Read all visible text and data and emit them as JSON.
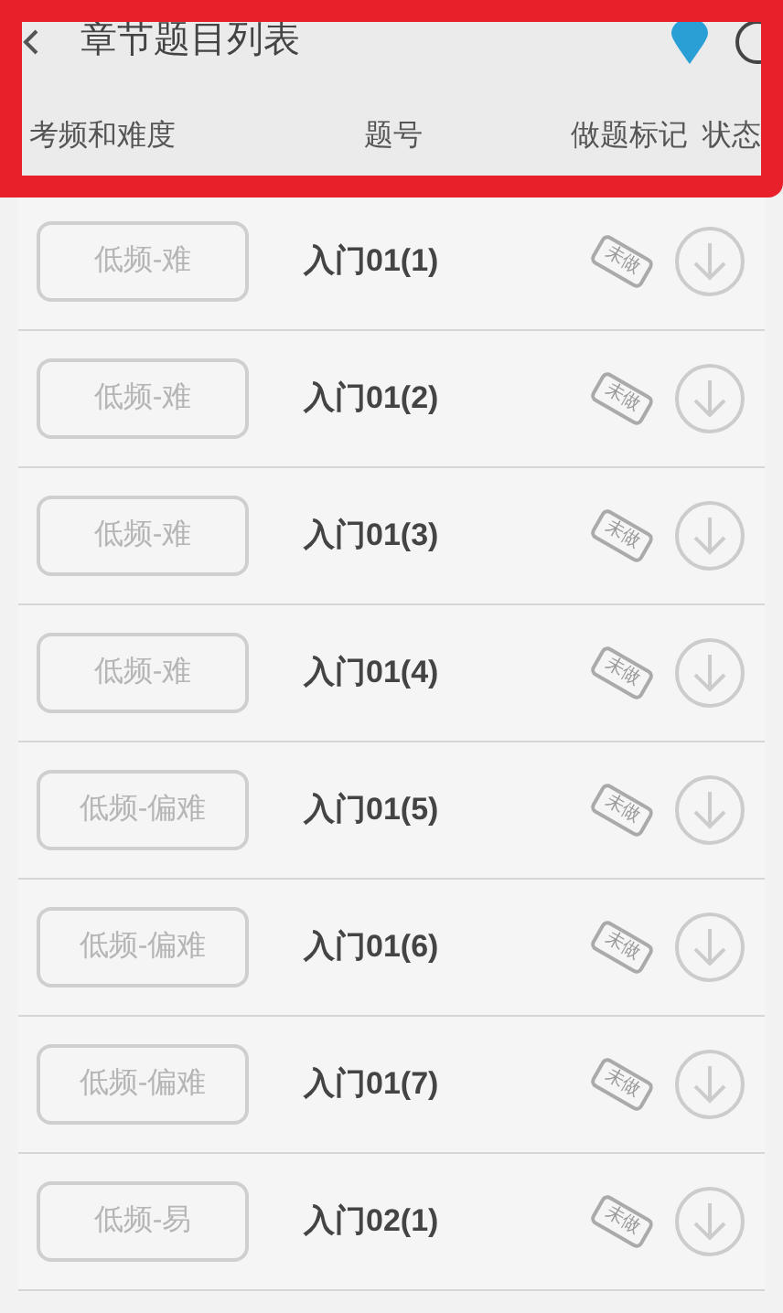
{
  "header": {
    "title": "章节题目列表",
    "columns": [
      "考频和难度",
      "题号",
      "做题标记",
      "状态"
    ]
  },
  "rows": [
    {
      "level": "低频-难",
      "number": "入门01(1)",
      "mark": "未做"
    },
    {
      "level": "低频-难",
      "number": "入门01(2)",
      "mark": "未做"
    },
    {
      "level": "低频-难",
      "number": "入门01(3)",
      "mark": "未做"
    },
    {
      "level": "低频-难",
      "number": "入门01(4)",
      "mark": "未做"
    },
    {
      "level": "低频-偏难",
      "number": "入门01(5)",
      "mark": "未做"
    },
    {
      "level": "低频-偏难",
      "number": "入门01(6)",
      "mark": "未做"
    },
    {
      "level": "低频-偏难",
      "number": "入门01(7)",
      "mark": "未做"
    },
    {
      "level": "低频-易",
      "number": "入门02(1)",
      "mark": "未做"
    }
  ]
}
